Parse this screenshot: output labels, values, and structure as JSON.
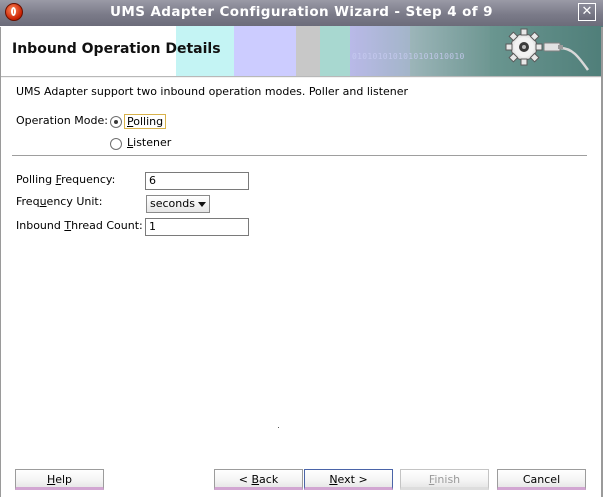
{
  "window": {
    "title": "UMS Adapter Configuration Wizard - Step 4 of 9",
    "close_glyph": "✕",
    "app_icon": "oracle-logo-icon"
  },
  "header": {
    "page_title": "Inbound Operation Details",
    "band_colors": [
      "#c4f4f4",
      "#a8e6ec",
      "#ccccff",
      "#c8c8c8",
      "#a8d8d0",
      "#8aa7a8",
      "#5f8f88"
    ],
    "binary_text": "0101010101010101010010",
    "illustration_icon": "gear-with-plug-icon"
  },
  "content": {
    "description": "UMS Adapter support two inbound operation modes. Poller and listener",
    "operation_mode": {
      "label": "Operation Mode:",
      "options": [
        {
          "label": "Polling",
          "selected": true
        },
        {
          "label": "Listener",
          "selected": false
        }
      ]
    },
    "fields": {
      "polling_frequency": {
        "label": "Polling Frequency:",
        "value": "6"
      },
      "frequency_unit": {
        "label": "Frequency Unit:",
        "value": "seconds"
      },
      "inbound_thread_count": {
        "label": "Inbound Thread Count:",
        "value": "1"
      }
    }
  },
  "footer": {
    "help": "Help",
    "back": "< Back",
    "next": "Next >",
    "finish": "Finish",
    "cancel": "Cancel"
  },
  "colors": {
    "button_bottom_accent": "#d2a6d2",
    "focus_border": "#d8b24a"
  }
}
